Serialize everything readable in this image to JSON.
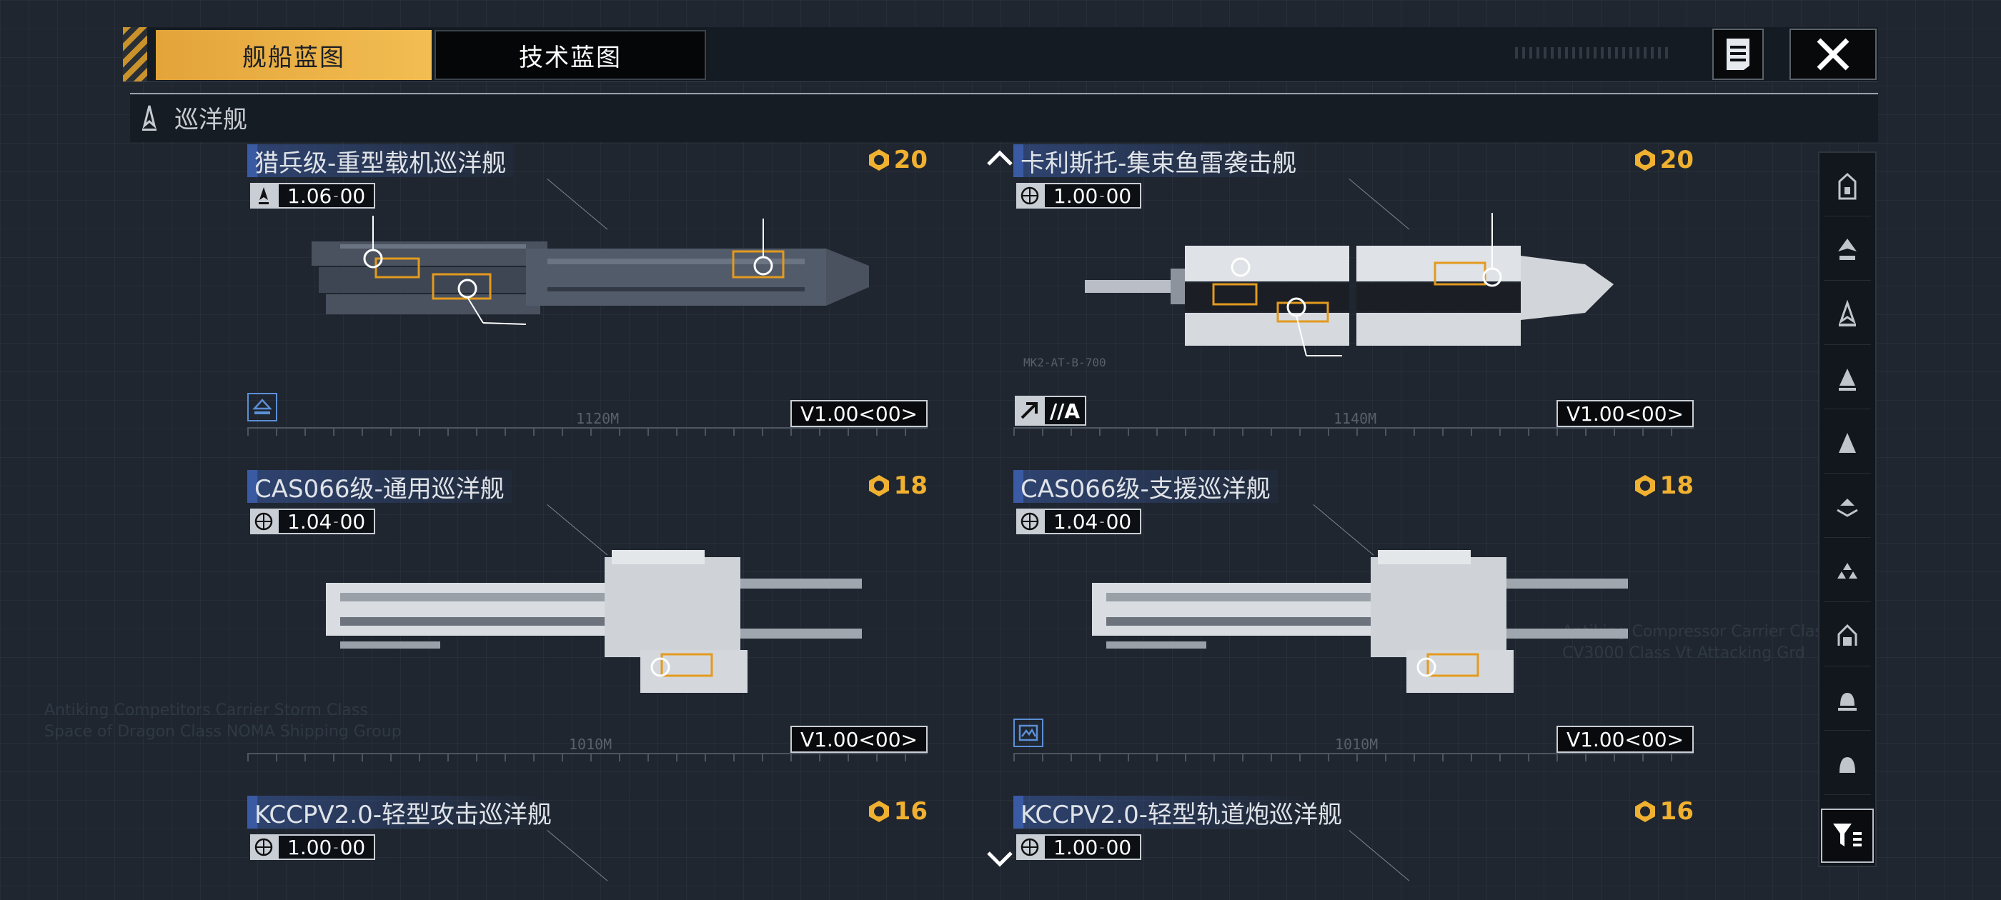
{
  "tabs": [
    {
      "label": "舰船蓝图",
      "active": true
    },
    {
      "label": "技术蓝图",
      "active": false
    }
  ],
  "category": {
    "label": "巡洋舰",
    "icon": "cruiser-icon"
  },
  "cards": [
    {
      "title": "猎兵级-重型载机巡洋舰",
      "score": "20",
      "version": "1.06",
      "version_sub": "00",
      "version_icon": "cruiser-icon",
      "tag": "V1.00<00>",
      "length": "1120M",
      "ship_color": "dark",
      "badge": "carrier-badge-icon"
    },
    {
      "title": "卡利斯托-集束鱼雷袭击舰",
      "score": "20",
      "version": "1.00",
      "version_sub": "00",
      "version_icon": "globe-icon",
      "tag": "V1.00<00>",
      "length": "1140M",
      "ship_color": "light",
      "grade": "//A",
      "model_code": "MK2-AT-B-700"
    },
    {
      "title": "CAS066级-通用巡洋舰",
      "score": "18",
      "version": "1.04",
      "version_sub": "00",
      "version_icon": "globe-icon",
      "tag": "V1.00<00>",
      "length": "1010M",
      "ship_color": "light"
    },
    {
      "title": "CAS066级-支援巡洋舰",
      "score": "18",
      "version": "1.04",
      "version_sub": "00",
      "version_icon": "globe-icon",
      "tag": "V1.00<00>",
      "length": "1010M",
      "ship_color": "light",
      "badge": "support-badge-icon"
    },
    {
      "title": "KCCPV2.0-轻型攻击巡洋舰",
      "score": "16",
      "version": "1.00",
      "version_sub": "00",
      "version_icon": "globe-icon"
    },
    {
      "title": "KCCPV2.0-轻型轨道炮巡洋舰",
      "score": "16",
      "version": "1.00",
      "version_sub": "00",
      "version_icon": "globe-icon"
    }
  ],
  "bg_text": {
    "left": "Antiking Competitors Carrier Storm Class\nSpace of Dragon Class NOMA Shipping Group",
    "right": "Antiking Compressor Carrier Class\nCV3000 Class Vt Attacking Grd"
  },
  "sidebar": {
    "filters": [
      "all-ships-icon",
      "carrier-icon",
      "cruiser-icon",
      "battlecruiser-icon",
      "destroyer-icon",
      "frigate-icon",
      "corvette-icon",
      "aux-ship-icon",
      "dock-icon",
      "fighter-icon"
    ],
    "filter_button": "filter-icon"
  },
  "colors": {
    "accent": "#f0b030",
    "tab_active": "#e8ad40",
    "title_bar": "#3a5aa3",
    "background": "#1f2630"
  }
}
